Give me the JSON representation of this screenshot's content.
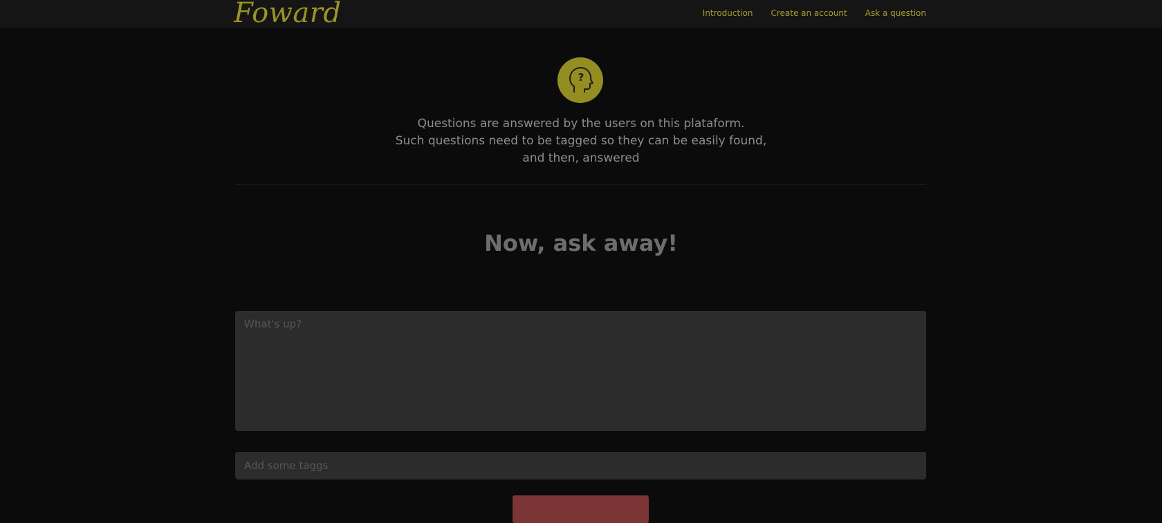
{
  "header": {
    "logo_text": "Foward",
    "nav": [
      {
        "label": "Introduction"
      },
      {
        "label": "Create an account"
      },
      {
        "label": "Ask a question"
      }
    ]
  },
  "hero": {
    "icon": "head-question-icon",
    "lines": [
      "Questions are answered by the users on this plataform.",
      "Such questions need to be tagged so they can be easily found,",
      "and then, answered"
    ]
  },
  "main": {
    "heading": "Now, ask away!",
    "question_placeholder": "What's up?",
    "tags_placeholder": "Add some taggs"
  },
  "colors": {
    "accent": "#9c9420",
    "background": "#0b0b0c",
    "field": "#2c2c2d",
    "submit": "#7a3534"
  }
}
